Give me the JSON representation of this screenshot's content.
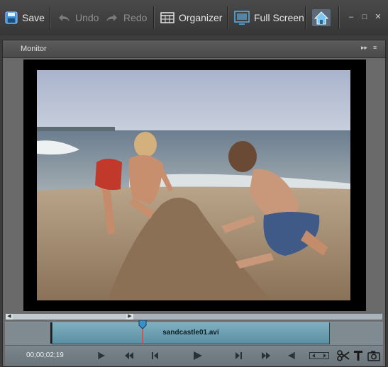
{
  "toolbar": {
    "save_label": "Save",
    "undo_label": "Undo",
    "redo_label": "Redo",
    "organizer_label": "Organizer",
    "fullscreen_label": "Full Screen",
    "icons": [
      "save-icon",
      "undo-icon",
      "redo-icon",
      "organizer-icon",
      "full-screen-icon",
      "home-icon"
    ],
    "window_buttons": {
      "minimize": "–",
      "maximize": "□",
      "close": "✕"
    }
  },
  "monitor": {
    "title": "Monitor",
    "header_button": "▸▸",
    "menu_button": "≡"
  },
  "timeline": {
    "clip_name": "sandcastle01.avi",
    "playhead_time": "00;00;02;19"
  },
  "colors": {
    "toolbar_bg": "#3e3e3e",
    "panel_bg": "#6a6a6a",
    "clip_fill": "#6fa1b4",
    "playhead_blue": "#3b8fc7"
  }
}
